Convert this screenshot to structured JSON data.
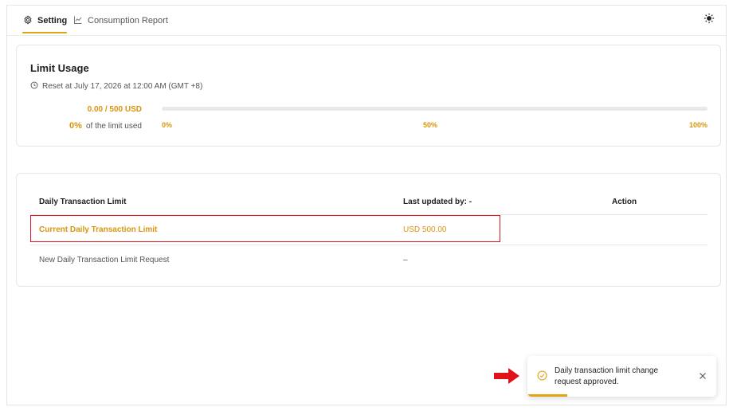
{
  "tabs": [
    {
      "label": "Setting",
      "icon": "gear-icon",
      "active": true
    },
    {
      "label": "Consumption Report",
      "icon": "line-chart-icon",
      "active": false
    }
  ],
  "header": {
    "theme_icon": "sun-icon"
  },
  "usage": {
    "title": "Limit Usage",
    "reset_text": "Reset at July 17, 2026 at 12:00 AM (GMT +8)",
    "amount": "0.00 / 500 USD",
    "percent": "0%",
    "percent_suffix": "of the limit used",
    "progress_fraction": 0,
    "ticks": [
      "0%",
      "50%",
      "100%"
    ],
    "accent_color": "#e2a316"
  },
  "limits": {
    "headers": {
      "name": "Daily Transaction Limit",
      "updated": "Last updated by: -",
      "action": "Action"
    },
    "rows": [
      {
        "name": "Current Daily Transaction Limit",
        "value": "USD 500.00"
      },
      {
        "name": "New Daily Transaction Limit Request",
        "value": "–"
      }
    ]
  },
  "toast": {
    "message": "Daily transaction limit change request approved.",
    "icon": "check-circle-icon",
    "close_icon": "close-icon"
  }
}
